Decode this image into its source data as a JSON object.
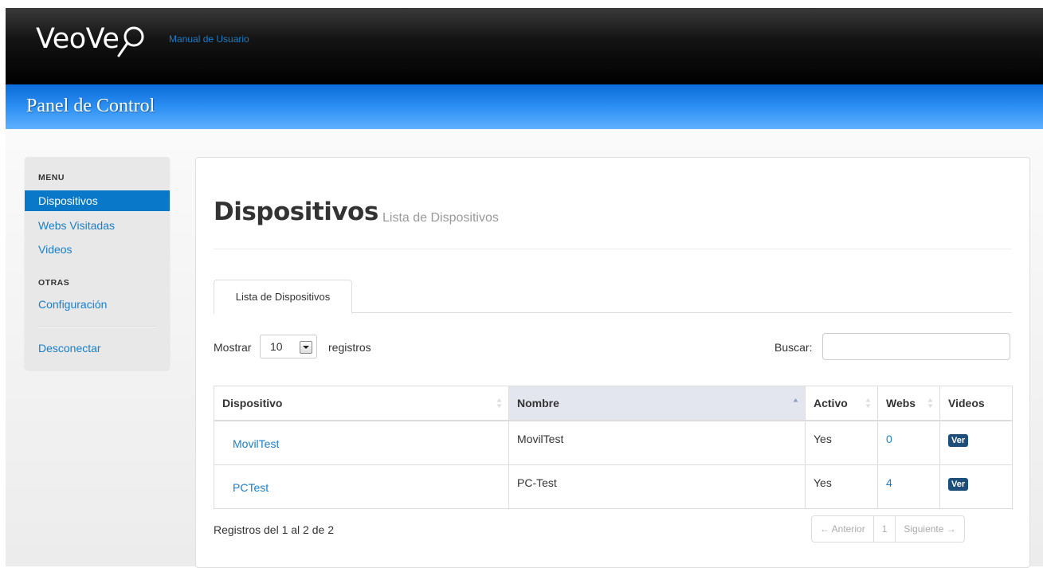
{
  "header": {
    "logo_text": "VeoVe",
    "manual_link": "Manual de Usuario",
    "panel_title": "Panel de Control"
  },
  "sidebar": {
    "menu_header": "MENU",
    "items": [
      {
        "label": "Dispositivos",
        "active": true
      },
      {
        "label": "Webs Visitadas"
      },
      {
        "label": "Videos"
      }
    ],
    "other_header": "OTRAS",
    "config_label": "Configuración",
    "logout_label": "Desconectar"
  },
  "main": {
    "title": "Dispositivos",
    "subtitle": "Lista de Dispositivos",
    "tab_label": "Lista de Dispositivos",
    "length": {
      "before": "Mostrar",
      "value": "10",
      "after": "registros"
    },
    "search_label": "Buscar:",
    "search_value": "",
    "table": {
      "columns": [
        "Dispositivo",
        "Nombre",
        "Activo",
        "Webs",
        "Videos"
      ],
      "sorted_column": "Nombre",
      "rows": [
        {
          "dispositivo": "MovilTest",
          "nombre": "MovilTest",
          "activo": "Yes",
          "webs": "0",
          "videos": "Ver"
        },
        {
          "dispositivo": "PCTest",
          "nombre": "PC-Test",
          "activo": "Yes",
          "webs": "4",
          "videos": "Ver"
        }
      ]
    },
    "info": "Registros del 1 al 2 de 2",
    "pagination": {
      "prev": "← Anterior",
      "page": "1",
      "next": "Siguiente →"
    }
  },
  "colors": {
    "accent": "#1a7ec8",
    "header_blue": "#2c8ff2",
    "active_item": "#0a78c8",
    "badge": "#1d4f7a"
  }
}
